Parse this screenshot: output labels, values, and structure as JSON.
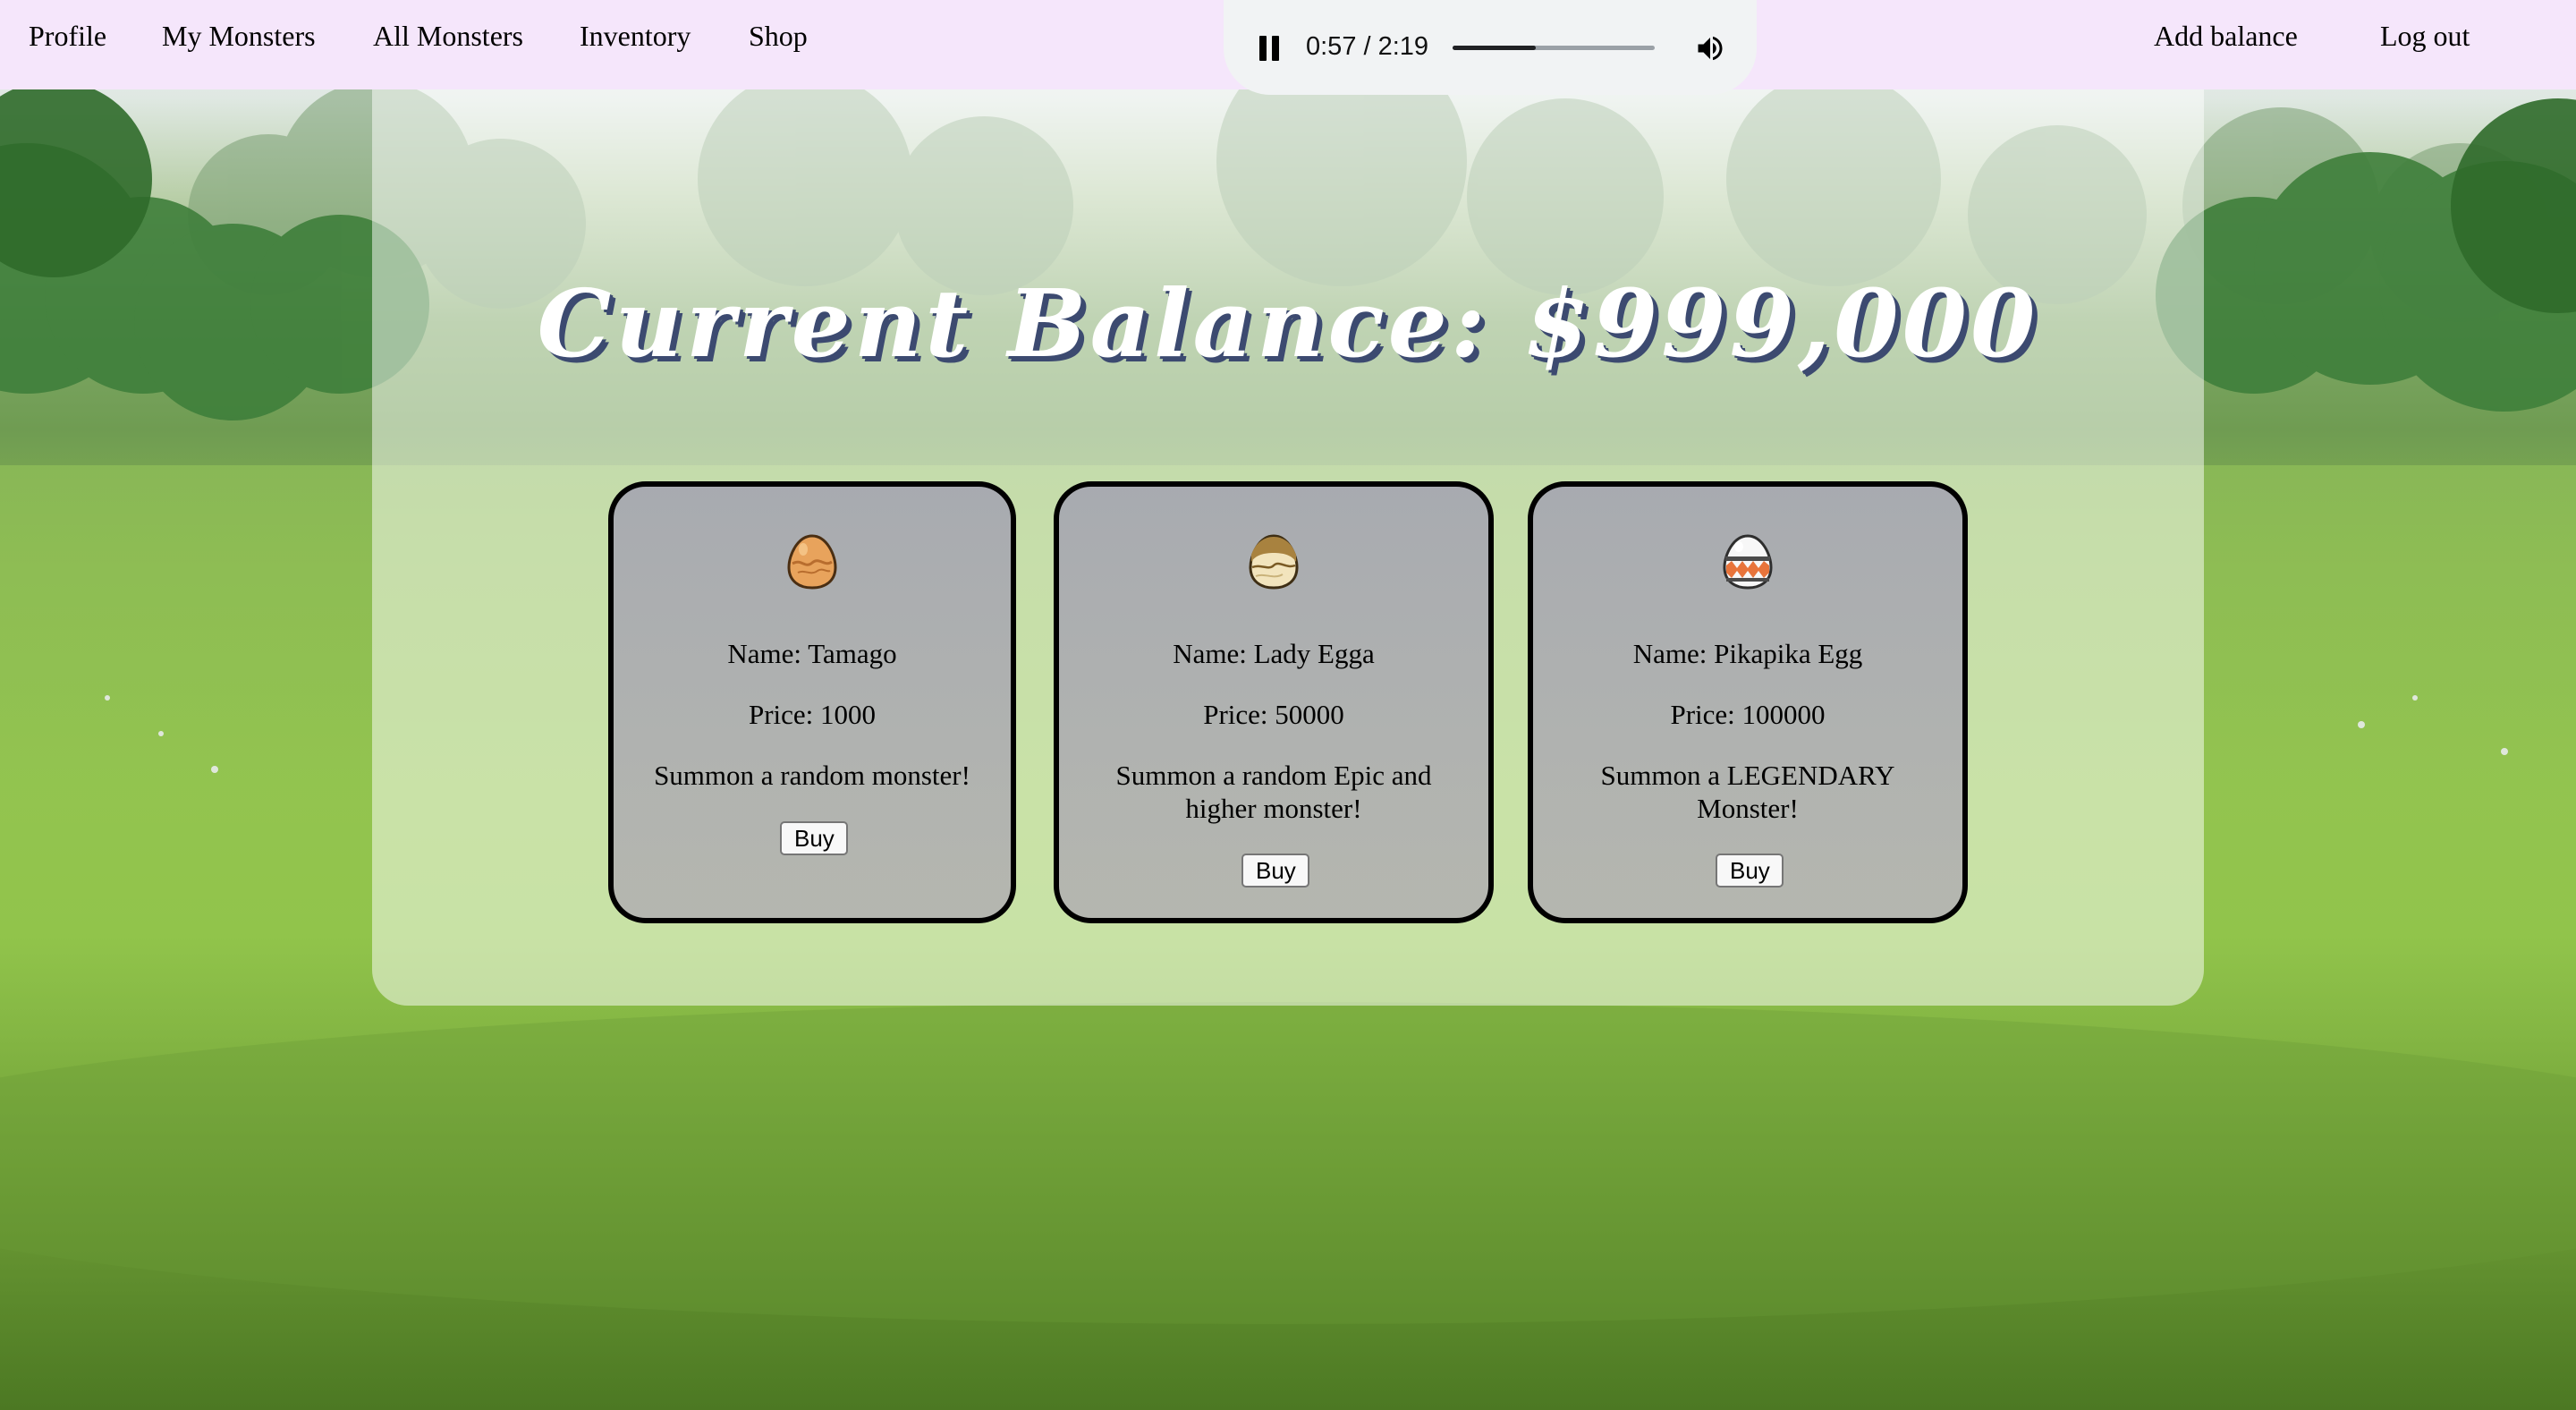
{
  "nav": {
    "profile": "Profile",
    "my_monsters": "My Monsters",
    "all_monsters": "All Monsters",
    "inventory": "Inventory",
    "shop": "Shop",
    "add_balance": "Add balance",
    "log_out": "Log out"
  },
  "player": {
    "time": "0:57 / 2:19",
    "progress_fraction": 0.41,
    "play_state_icon": "pause-icon",
    "volume_icon": "volume-icon"
  },
  "shop": {
    "balance_title": "Current Balance: $999,000",
    "items": [
      {
        "name": "Name: Tamago",
        "price": "Price: 1000",
        "description": "Summon a random monster!",
        "buy_label": "Buy",
        "icon": "egg-orange-icon"
      },
      {
        "name": "Name: Lady Egga",
        "price": "Price: 50000",
        "description_line1": "Summon a random Epic and",
        "description_line2": "higher monster!",
        "buy_label": "Buy",
        "icon": "egg-tan-icon"
      },
      {
        "name": "Name: Pikapika Egg",
        "price": "Price: 100000",
        "description_line1": "Summon a LEGENDARY",
        "description_line2": "Monster!",
        "buy_label": "Buy",
        "icon": "egg-white-icon"
      }
    ]
  },
  "colors": {
    "navbar_bg": "#f5e6fb",
    "title_shadow": "#3c4a70",
    "card_border": "#000000"
  }
}
